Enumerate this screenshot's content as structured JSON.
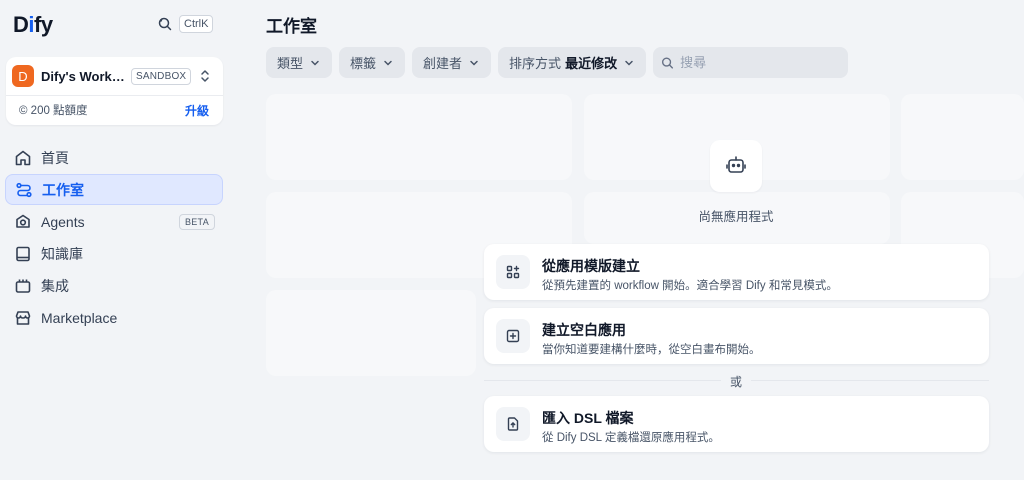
{
  "logo": {
    "prefix": "D",
    "accent": "i",
    "suffix": "fy"
  },
  "search_shortcut": "CtrlK",
  "workspace": {
    "avatar": "D",
    "name": "Dify's Workspace",
    "badge": "SANDBOX",
    "credits": "© 200 點額度",
    "upgrade": "升級"
  },
  "nav": [
    {
      "label": "首頁",
      "icon": "home-icon"
    },
    {
      "label": "工作室",
      "icon": "studio-icon",
      "active": true
    },
    {
      "label": "Agents",
      "icon": "agents-icon",
      "badge": "BETA"
    },
    {
      "label": "知識庫",
      "icon": "book-icon"
    },
    {
      "label": "集成",
      "icon": "plugin-icon"
    },
    {
      "label": "Marketplace",
      "icon": "store-icon"
    }
  ],
  "page": {
    "title": "工作室"
  },
  "filters": {
    "type": "類型",
    "tags": "標籤",
    "creator": "創建者",
    "sort_label": "排序方式",
    "sort_value": "最近修改",
    "search_placeholder": "搜尋"
  },
  "empty": {
    "text": "尚無應用程式",
    "icon": "robot-icon"
  },
  "options": [
    {
      "title": "從應用模版建立",
      "desc": "從預先建置的 workflow 開始。適合學習 Dify 和常見模式。",
      "icon": "template-icon"
    },
    {
      "title": "建立空白應用",
      "desc": "當你知道要建構什麼時，從空白畫布開始。",
      "icon": "blank-app-icon"
    },
    {
      "title": "匯入 DSL 檔案",
      "desc": "從 Dify DSL 定義檔還原應用程式。",
      "icon": "import-icon"
    }
  ],
  "or": "或",
  "colors": {
    "accent": "#155eef",
    "avatar": "#ef6820",
    "background": "#f2f4f7"
  }
}
